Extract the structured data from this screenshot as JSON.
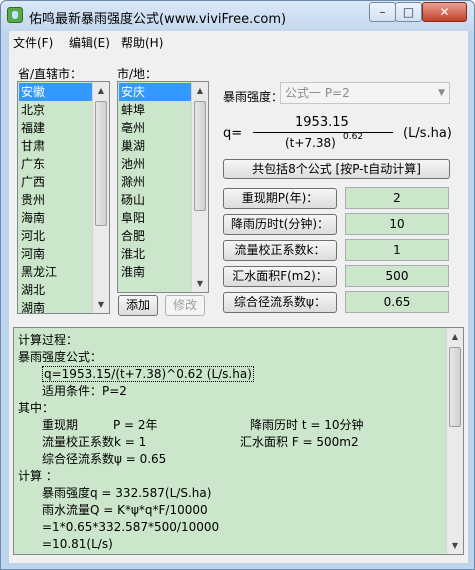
{
  "window": {
    "title": "佑鸣最新暴雨强度公式(www.viviFree.com)",
    "minimize_glyph": "–",
    "maximize_glyph": "□",
    "close_glyph": "✕"
  },
  "menu": [
    {
      "label": "文件(F)"
    },
    {
      "label": "编辑(E)"
    },
    {
      "label": "帮助(H)"
    }
  ],
  "province": {
    "label": "省/直辖市：",
    "items": [
      "安徽",
      "北京",
      "福建",
      "甘肃",
      "广东",
      "广西",
      "贵州",
      "海南",
      "河北",
      "河南",
      "黑龙江",
      "湖北",
      "湖南"
    ],
    "selected": "安徽"
  },
  "city": {
    "label": "市/地：",
    "items": [
      "安庆",
      "蚌埠",
      "亳州",
      "巢湖",
      "池州",
      "滁州",
      "砀山",
      "阜阳",
      "合肥",
      "淮北",
      "淮南"
    ],
    "selected": "安庆",
    "add_label": "添加",
    "edit_label": "修改"
  },
  "intensity": {
    "label": "暴雨强度：",
    "selected_formula": "公式一 P=2"
  },
  "formula": {
    "lhs": "q=",
    "numerator": "1953.15",
    "denominator": "(t+7.38)",
    "exponent": "0.62",
    "unit": "(L/s.ha)"
  },
  "summary_button": "共包括8个公式 [按P-t自动计算]",
  "params": [
    {
      "label": "重现期P(年)：",
      "value": "2"
    },
    {
      "label": "降雨历时t(分钟)：",
      "value": "10"
    },
    {
      "label": "流量校正系数k：",
      "value": "1"
    },
    {
      "label": "汇水面积F(m2)：",
      "value": "500"
    },
    {
      "label": "综合径流系数ψ：",
      "value": "0.65"
    }
  ],
  "process": {
    "l1": "计算过程：",
    "l2": "暴雨强度公式：",
    "l3": "q=1953.15/(t+7.38)^0.62 (L/s.ha)",
    "l4": "适用条件：P=2",
    "l5": "其中：",
    "l6a": "重现期",
    "l6b": "P = 2年",
    "l6c": "降雨历时 t = 10分钟",
    "l7a": "流量校正系数k = 1",
    "l7b": "汇水面积 F = 500m2",
    "l8": "综合径流系数ψ = 0.65",
    "l9": "计算 ：",
    "l10": "暴雨强度q = 332.587(L/S.ha)",
    "l11": "雨水流量Q = K*ψ*q*F/10000",
    "l12": "=1*0.65*332.587*500/10000",
    "l13": "=10.81(L/s)"
  },
  "colors": {
    "list_bg": "#cbe6cb",
    "selection": "#3399ff",
    "window_chrome": "#bcd4ee"
  }
}
